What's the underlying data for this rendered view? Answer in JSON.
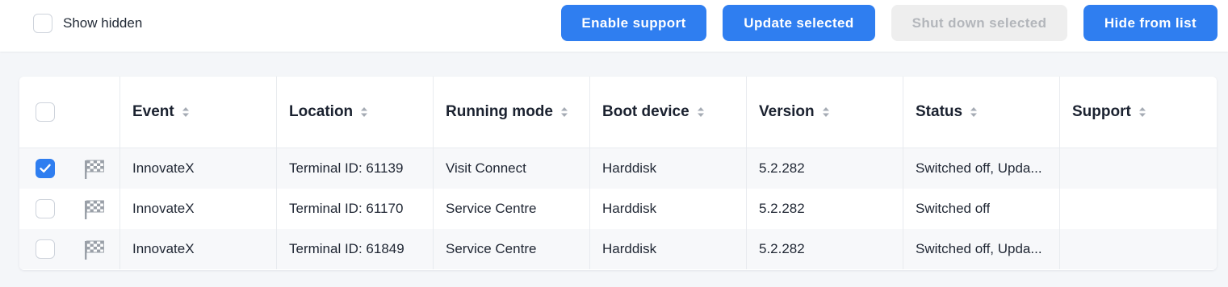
{
  "toolbar": {
    "show_hidden_label": "Show hidden",
    "enable_support": "Enable support",
    "update_selected": "Update selected",
    "shut_down_selected": "Shut down selected",
    "hide_from_list": "Hide from list"
  },
  "table": {
    "headers": {
      "event": "Event",
      "location": "Location",
      "running_mode": "Running mode",
      "boot_device": "Boot device",
      "version": "Version",
      "status": "Status",
      "support": "Support"
    },
    "rows": [
      {
        "checked": true,
        "event": "InnovateX",
        "location": "Terminal ID: 61139",
        "running_mode": "Visit Connect",
        "boot_device": "Harddisk",
        "version": "5.2.282",
        "status": "Switched off, Upda...",
        "support": ""
      },
      {
        "checked": false,
        "event": "InnovateX",
        "location": "Terminal ID: 61170",
        "running_mode": "Service Centre",
        "boot_device": "Harddisk",
        "version": "5.2.282",
        "status": "Switched off",
        "support": ""
      },
      {
        "checked": false,
        "event": "InnovateX",
        "location": "Terminal ID: 61849",
        "running_mode": "Service Centre",
        "boot_device": "Harddisk",
        "version": "5.2.282",
        "status": "Switched off, Upda...",
        "support": ""
      }
    ]
  },
  "colors": {
    "accent": "#2f7ef0",
    "disabled_bg": "#eeeeee",
    "disabled_text": "#b3b6bb"
  },
  "icons": {
    "row_flag": "checkered-flag-icon",
    "sort": "sort-icon",
    "check": "checkmark-icon"
  }
}
